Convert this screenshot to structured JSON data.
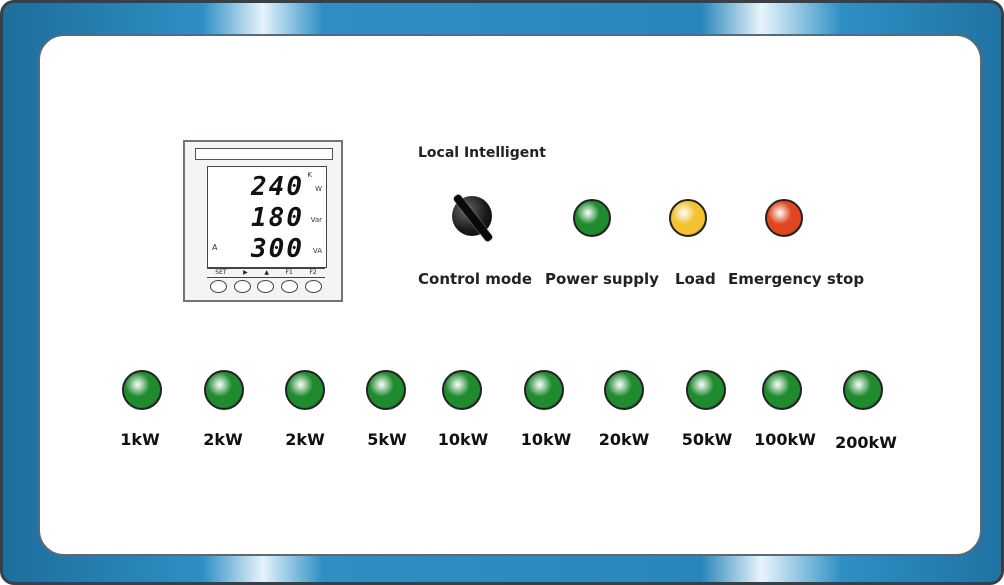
{
  "meter": {
    "readings": [
      "240",
      "180",
      "300"
    ],
    "unit_labels": [
      "W",
      "Var",
      "VA"
    ],
    "prefix_label": "K",
    "phase_label": "A",
    "keys": [
      "SET",
      "▶",
      "▲",
      "F1",
      "F2"
    ]
  },
  "control_mode": {
    "caption": "Local  Intelligent",
    "label": "Control mode"
  },
  "indicators": [
    {
      "label": "Power supply",
      "color": "#1f8a2e"
    },
    {
      "label": "Load",
      "color": "#f2c230"
    },
    {
      "label": "Emergency stop",
      "color": "#e0461f"
    }
  ],
  "power_steps": [
    {
      "label": "1kW",
      "color": "#1f8a2e"
    },
    {
      "label": "2kW",
      "color": "#1f8a2e"
    },
    {
      "label": "2kW",
      "color": "#1f8a2e"
    },
    {
      "label": "5kW",
      "color": "#1f8a2e"
    },
    {
      "label": "10kW",
      "color": "#1f8a2e"
    },
    {
      "label": "10kW",
      "color": "#1f8a2e"
    },
    {
      "label": "20kW",
      "color": "#1f8a2e"
    },
    {
      "label": "50kW",
      "color": "#1f8a2e"
    },
    {
      "label": "100kW",
      "color": "#1f8a2e"
    },
    {
      "label": "200kW",
      "color": "#1f8a2e"
    }
  ]
}
